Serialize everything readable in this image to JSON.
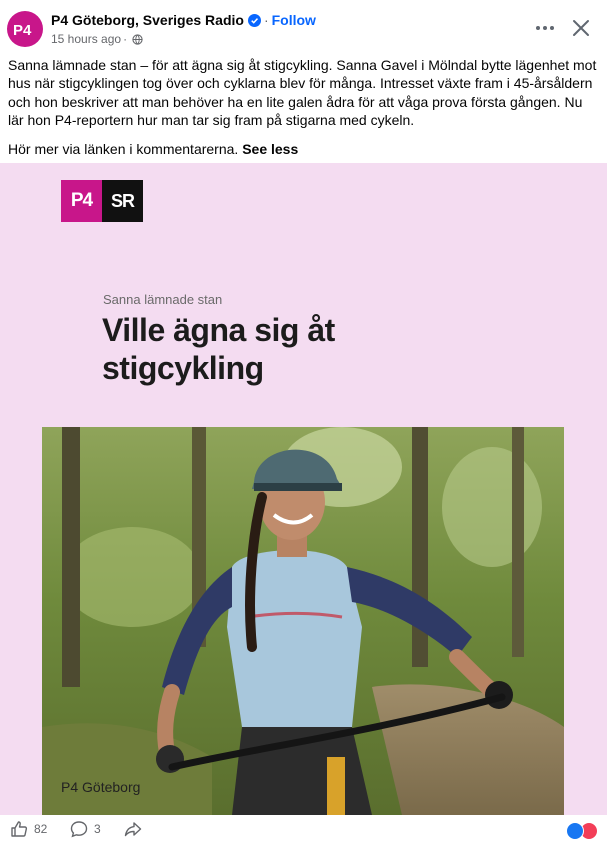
{
  "post": {
    "page_name": "P4 Göteborg, Sveriges Radio",
    "follow_label": "Follow",
    "separator": "·",
    "timestamp": "15 hours ago",
    "meta_separator": "·",
    "body": "Sanna lämnade stan – för att ägna sig åt stigcykling. Sanna Gavel i Mölndal bytte lägenhet mot hus när stigcyklingen tog över och cyklarna blev för många. Intresset växte fram i 45-årsåldern och hon beskriver att man behöver ha en lite galen ådra för att våga prova första gången. Nu lär hon P4-reportern hur man tar sig fram på stigarna med cykeln.",
    "link_note": "Hör mer via länken i kommentarerna.",
    "see_less_label": "See less",
    "icons": {
      "avatar": "p4-logo-icon",
      "verified": "verified-badge-icon",
      "privacy": "globe-icon",
      "more": "more-dots-icon",
      "close": "close-icon"
    }
  },
  "media": {
    "logo_left": "P4",
    "logo_right": "SR",
    "kicker": "Sanna lämnade stan",
    "headline": "Ville ägna sig åt stigcykling",
    "station_label": "P4 Göteborg",
    "colors": {
      "background": "#f4dcf1",
      "brand_pink": "#c8168a"
    }
  },
  "actions": {
    "like_count": "82",
    "comment_count": "3",
    "icons": {
      "like": "thumbs-up-icon",
      "comment": "comment-icon",
      "share": "share-icon"
    },
    "reactions": [
      "like-reaction-icon",
      "love-reaction-icon"
    ]
  },
  "colors": {
    "link": "#0866ff",
    "text": "#050505",
    "secondary": "#65676b"
  }
}
